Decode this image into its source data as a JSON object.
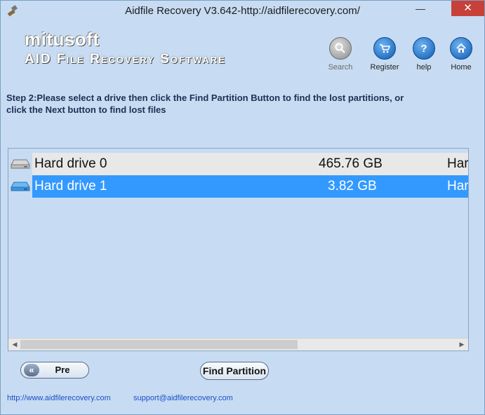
{
  "window": {
    "title": "Aidfile Recovery V3.642-http://aidfilerecovery.com/",
    "minimize_glyph": "—",
    "close_glyph": "✕"
  },
  "header": {
    "brand": "mitusoft",
    "tagline": "AID File Recovery Software",
    "buttons": [
      {
        "label": "Search",
        "icon": "search-icon",
        "color": "#9b9b9b"
      },
      {
        "label": "Register",
        "icon": "cart-icon",
        "color": "#1e6fc6"
      },
      {
        "label": "help",
        "icon": "help-icon",
        "color": "#1e6fc6"
      },
      {
        "label": "Home",
        "icon": "home-icon",
        "color": "#1e6fc6"
      }
    ]
  },
  "instructions": {
    "line1": "Step 2:Please select a drive then click the Find Partition Button to find the lost partitions, or",
    "line2": "click the Next button to find lost files"
  },
  "drives": {
    "rows": [
      {
        "name": "Hard drive 0",
        "size": "465.76 GB",
        "type": "Har",
        "selected": false
      },
      {
        "name": "Hard drive 1",
        "size": "3.82 GB",
        "type": "Har",
        "selected": true
      }
    ],
    "selection_color": "#3399ff"
  },
  "buttons": {
    "pre_chevron": "«",
    "pre": "Pre",
    "find_partition": "Find Partition"
  },
  "footer": {
    "website": "http://www.aidfilerecovery.com",
    "email": "support@aidfilerecovery.com"
  }
}
